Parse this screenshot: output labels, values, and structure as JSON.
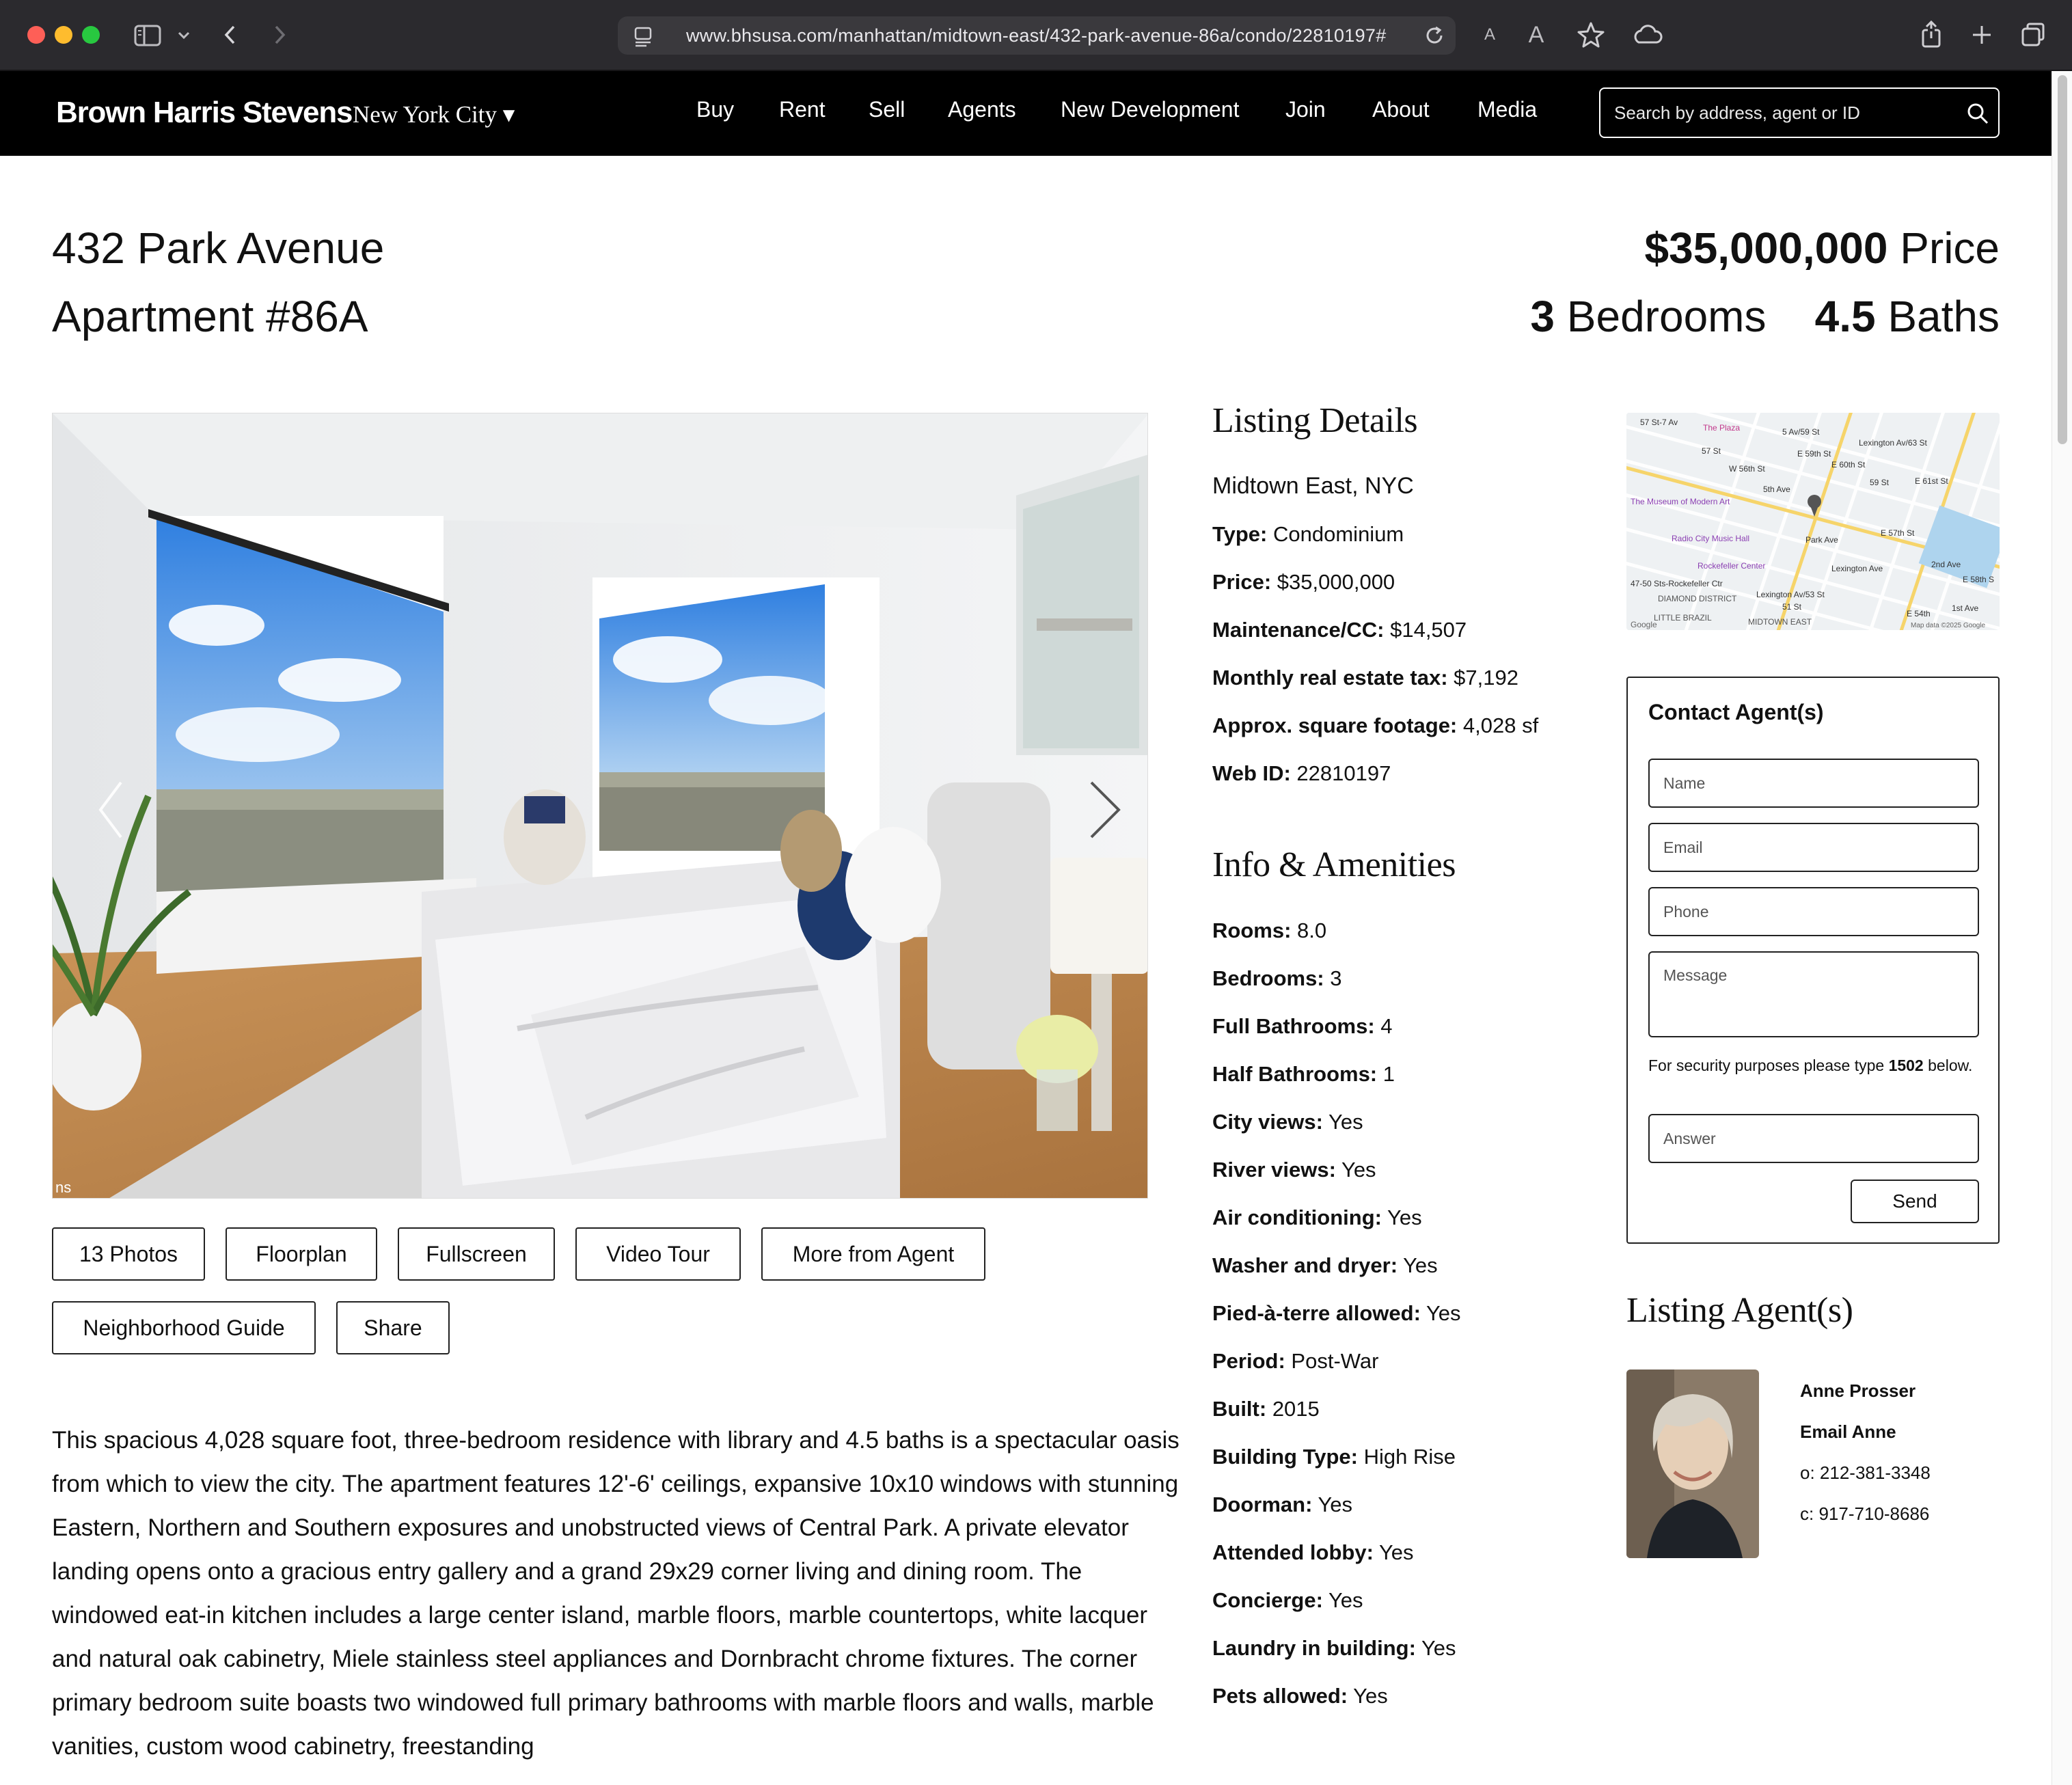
{
  "browser": {
    "url": "www.bhsusa.com/manhattan/midtown-east/432-park-avenue-86a/condo/22810197#",
    "icons": [
      "sidebar-icon",
      "chevron-down-icon",
      "back-arrow-icon",
      "forward-arrow-icon",
      "page-menu-icon",
      "reload-icon",
      "text-smaller-icon",
      "text-larger-icon",
      "star-icon",
      "cloud-icon",
      "share-icon",
      "new-tab-plus-icon",
      "tab-overview-icon"
    ],
    "text_small": "A",
    "text_large": "A"
  },
  "header": {
    "logo": "Brown Harris Stevens",
    "city": "New York City ▾",
    "nav": [
      "Buy",
      "Rent",
      "Sell",
      "Agents",
      "New Development",
      "Join",
      "About",
      "Media"
    ],
    "search_placeholder": "Search by address, agent or ID"
  },
  "listing": {
    "address": "432 Park Avenue",
    "unit": "Apartment #86A",
    "price_value": "$35,000,000",
    "price_label": "Price",
    "bedrooms_value": "3",
    "bedrooms_label": "Bedrooms",
    "baths_value": "4.5",
    "baths_label": "Baths"
  },
  "photo_buttons": [
    "13 Photos",
    "Floorplan",
    "Fullscreen",
    "Video Tour",
    "More from Agent",
    "Neighborhood Guide",
    "Share"
  ],
  "photo_watermark": "ns",
  "description": "This spacious 4,028 square foot, three-bedroom residence with library and 4.5 baths is a spectacular oasis from which to view the city. The apartment features 12'-6' ceilings, expansive 10x10 windows with stunning Eastern, Northern and Southern exposures and unobstructed views of Central Park. A private elevator landing opens onto a gracious entry gallery and a grand 29x29 corner living and dining room. The windowed eat-in kitchen includes a large center island, marble floors, marble countertops, white lacquer and natural oak cabinetry, Miele stainless steel appliances and Dornbracht chrome fixtures. The corner primary bedroom suite boasts two windowed full primary bathrooms with marble floors and walls, marble vanities, custom wood cabinetry, freestanding",
  "details": {
    "heading": "Listing Details",
    "location": "Midtown East, NYC",
    "rows": [
      {
        "label": "Type:",
        "value": " Condominium"
      },
      {
        "label": "Price:",
        "value": " $35,000,000"
      },
      {
        "label": "Maintenance/CC:",
        "value": " $14,507"
      },
      {
        "label": "Monthly real estate tax:",
        "value": " $7,192"
      },
      {
        "label": "Approx. square footage:",
        "value": " 4,028 sf"
      },
      {
        "label": "Web ID:",
        "value": " 22810197"
      }
    ]
  },
  "amenities": {
    "heading": "Info & Amenities",
    "rows": [
      {
        "label": "Rooms:",
        "value": " 8.0"
      },
      {
        "label": "Bedrooms:",
        "value": " 3"
      },
      {
        "label": "Full Bathrooms:",
        "value": " 4"
      },
      {
        "label": "Half Bathrooms:",
        "value": " 1"
      },
      {
        "label": "City views:",
        "value": " Yes"
      },
      {
        "label": "River views:",
        "value": " Yes"
      },
      {
        "label": "Air conditioning:",
        "value": " Yes"
      },
      {
        "label": "Washer and dryer:",
        "value": " Yes"
      },
      {
        "label": "Pied-à-terre allowed:",
        "value": " Yes"
      },
      {
        "label": "Period:",
        "value": " Post-War"
      },
      {
        "label": "Built:",
        "value": " 2015"
      },
      {
        "label": "Building Type:",
        "value": " High Rise"
      },
      {
        "label": "Doorman:",
        "value": " Yes"
      },
      {
        "label": "Attended lobby:",
        "value": " Yes"
      },
      {
        "label": "Concierge:",
        "value": " Yes"
      },
      {
        "label": "Laundry in building:",
        "value": " Yes"
      },
      {
        "label": "Pets allowed:",
        "value": " Yes"
      }
    ]
  },
  "map": {
    "labels": [
      "57 St-7 Av",
      "The Plaza",
      "5 Av/59 St",
      "Lexington Av/63 St",
      "57 St",
      "E 59th St",
      "E 60th St",
      "W 56th St",
      "5th Ave",
      "59 St",
      "E 61st St",
      "The Museum of Modern Art",
      "Park Ave",
      "E 57th St",
      "Radio City Music Hall",
      "Lexington Ave",
      "2nd Ave",
      "Rockefeller Center",
      "E 58th S",
      "47-50 Sts-Rockefeller Ctr",
      "DIAMOND DISTRICT",
      "Lexington Av/53 St",
      "51 St",
      "1st Ave",
      "LITTLE BRAZIL",
      "MIDTOWN EAST",
      "E 54th",
      "Google",
      "Map data ©2025 Google"
    ]
  },
  "contact": {
    "title": "Contact Agent(s)",
    "name_placeholder": "Name",
    "email_placeholder": "Email",
    "phone_placeholder": "Phone",
    "message_placeholder": "Message",
    "security_pre": "For security purposes please type ",
    "security_code": "1502",
    "security_post": " below.",
    "answer_placeholder": "Answer",
    "send_label": "Send"
  },
  "agents": {
    "heading": "Listing Agent(s)",
    "name": "Anne Prosser",
    "email_label": "Email Anne",
    "office": "o: 212-381-3348",
    "cell": "c: 917-710-8686"
  }
}
